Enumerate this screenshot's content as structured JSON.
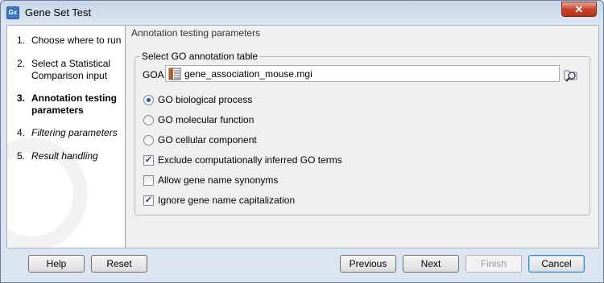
{
  "window": {
    "title": "Gene Set Test",
    "app_icon_text": "Gx",
    "close_label": "✕"
  },
  "sidebar": {
    "steps": [
      {
        "num": "1.",
        "label": "Choose where to run",
        "state": "done"
      },
      {
        "num": "2.",
        "label": "Select a Statistical Comparison input",
        "state": "done"
      },
      {
        "num": "3.",
        "label": "Annotation testing parameters",
        "state": "active"
      },
      {
        "num": "4.",
        "label": "Filtering parameters",
        "state": "future"
      },
      {
        "num": "5.",
        "label": "Result handling",
        "state": "future"
      }
    ]
  },
  "main": {
    "section_title": "Annotation testing parameters",
    "group_title": "Select GO annotation table",
    "goa_label": "GOA",
    "goa_value": "gene_association_mouse.mgi",
    "radios": [
      {
        "label": "GO biological process",
        "checked": true
      },
      {
        "label": "GO molecular function",
        "checked": false
      },
      {
        "label": "GO cellular component",
        "checked": false
      }
    ],
    "checkboxes": [
      {
        "label": "Exclude computationally inferred GO terms",
        "checked": true
      },
      {
        "label": "Allow gene name synonyms",
        "checked": false
      },
      {
        "label": "Ignore gene name capitalization",
        "checked": true
      }
    ]
  },
  "footer": {
    "help": "Help",
    "reset": "Reset",
    "previous": "Previous",
    "next": "Next",
    "finish": "Finish",
    "cancel": "Cancel"
  }
}
